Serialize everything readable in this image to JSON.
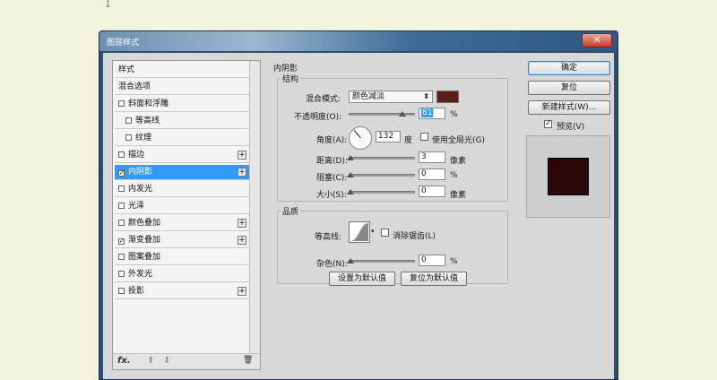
{
  "page_marker": "1",
  "window": {
    "title": "图层样式",
    "close_glyph": "✕"
  },
  "sidebar": {
    "items": [
      {
        "label": "样式",
        "checkbox": false,
        "indent": false,
        "plus": false,
        "selected": false,
        "checked": false
      },
      {
        "label": "混合选项",
        "checkbox": false,
        "indent": false,
        "plus": false,
        "selected": false,
        "checked": false
      },
      {
        "label": "斜面和浮雕",
        "checkbox": true,
        "indent": false,
        "plus": false,
        "selected": false,
        "checked": false
      },
      {
        "label": "等高线",
        "checkbox": true,
        "indent": true,
        "plus": false,
        "selected": false,
        "checked": false
      },
      {
        "label": "纹理",
        "checkbox": true,
        "indent": true,
        "plus": false,
        "selected": false,
        "checked": false
      },
      {
        "label": "描边",
        "checkbox": true,
        "indent": false,
        "plus": true,
        "selected": false,
        "checked": false
      },
      {
        "label": "内阴影",
        "checkbox": true,
        "indent": false,
        "plus": true,
        "selected": true,
        "checked": true
      },
      {
        "label": "内发光",
        "checkbox": true,
        "indent": false,
        "plus": false,
        "selected": false,
        "checked": false
      },
      {
        "label": "光泽",
        "checkbox": true,
        "indent": false,
        "plus": false,
        "selected": false,
        "checked": false
      },
      {
        "label": "颜色叠加",
        "checkbox": true,
        "indent": false,
        "plus": true,
        "selected": false,
        "checked": false
      },
      {
        "label": "渐变叠加",
        "checkbox": true,
        "indent": false,
        "plus": true,
        "selected": false,
        "checked": true
      },
      {
        "label": "图案叠加",
        "checkbox": true,
        "indent": false,
        "plus": false,
        "selected": false,
        "checked": false
      },
      {
        "label": "外发光",
        "checkbox": true,
        "indent": false,
        "plus": false,
        "selected": false,
        "checked": false
      },
      {
        "label": "投影",
        "checkbox": true,
        "indent": false,
        "plus": true,
        "selected": false,
        "checked": false
      }
    ],
    "footer": {
      "fx": "fx.",
      "up": "⬆",
      "down": "⬇",
      "trash": "🗑"
    }
  },
  "panel": {
    "title": "内阴影",
    "structure": {
      "label": "结构",
      "blend_mode_label": "混合模式:",
      "blend_mode_value": "颜色减淡",
      "swatch_color": "#5a1f18",
      "opacity_label": "不透明度(O):",
      "opacity_value": "81",
      "opacity_level": 0.81,
      "percent": "%",
      "angle_label": "角度(A):",
      "angle_value": "132",
      "angle_unit": "度",
      "global_light_label": "使用全局光(G)",
      "distance_label": "距离(D):",
      "distance_value": "3",
      "pixel_unit": "像素",
      "choke_label": "阻塞(C):",
      "choke_value": "0",
      "size_label": "大小(S):",
      "size_value": "0"
    },
    "quality": {
      "label": "品质",
      "contour_label": "等高线:",
      "antialias_label": "消除锯齿(L)",
      "noise_label": "杂色(N):",
      "noise_value": "0"
    },
    "make_default": "设置为默认值",
    "reset_default": "复位为默认值"
  },
  "actions": {
    "ok": "确定",
    "reset": "复位",
    "new_style": "新建样式(W)...",
    "preview_label": "预览(V)",
    "preview_checked": true,
    "preview_color": "#2b0707"
  }
}
